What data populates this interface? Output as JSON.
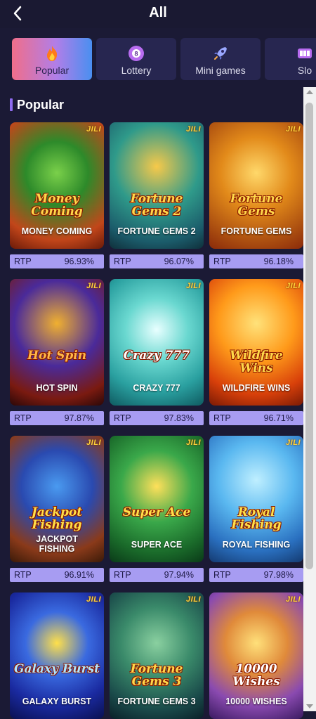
{
  "header": {
    "title": "All"
  },
  "tabs": [
    {
      "label": "Popular",
      "icon": "flame-icon",
      "active": true
    },
    {
      "label": "Lottery",
      "icon": "lottery-ball-icon",
      "active": false
    },
    {
      "label": "Mini games",
      "icon": "rocket-icon",
      "active": false
    },
    {
      "label": "Slo",
      "icon": "slots-icon",
      "active": false
    }
  ],
  "section": {
    "title": "Popular"
  },
  "rtp_label": "RTP",
  "provider": "JILI",
  "games": [
    {
      "name": "MONEY COMING",
      "logo": "Money Coming",
      "rtp": "96.93%"
    },
    {
      "name": "FORTUNE GEMS 2",
      "logo": "Fortune Gems 2",
      "rtp": "96.07%"
    },
    {
      "name": "FORTUNE GEMS",
      "logo": "Fortune Gems",
      "rtp": "96.18%"
    },
    {
      "name": "HOT SPIN",
      "logo": "Hot Spin",
      "rtp": "97.87%"
    },
    {
      "name": "CRAZY 777",
      "logo": "Crazy 777",
      "rtp": "97.83%"
    },
    {
      "name": "WILDFIRE WINS",
      "logo": "Wildfire Wins",
      "rtp": "96.71%"
    },
    {
      "name": "JACKPOT FISHING",
      "logo": "Jackpot Fishing",
      "rtp": "96.91%"
    },
    {
      "name": "SUPER ACE",
      "logo": "Super Ace",
      "rtp": "97.94%"
    },
    {
      "name": "ROYAL FISHING",
      "logo": "Royal Fishing",
      "rtp": "97.98%"
    },
    {
      "name": "GALAXY BURST",
      "logo": "Galaxy Burst",
      "rtp": ""
    },
    {
      "name": "FORTUNE GEMS 3",
      "logo": "Fortune Gems 3",
      "rtp": ""
    },
    {
      "name": "10000 WISHES",
      "logo": "10000 Wishes",
      "rtp": ""
    }
  ]
}
